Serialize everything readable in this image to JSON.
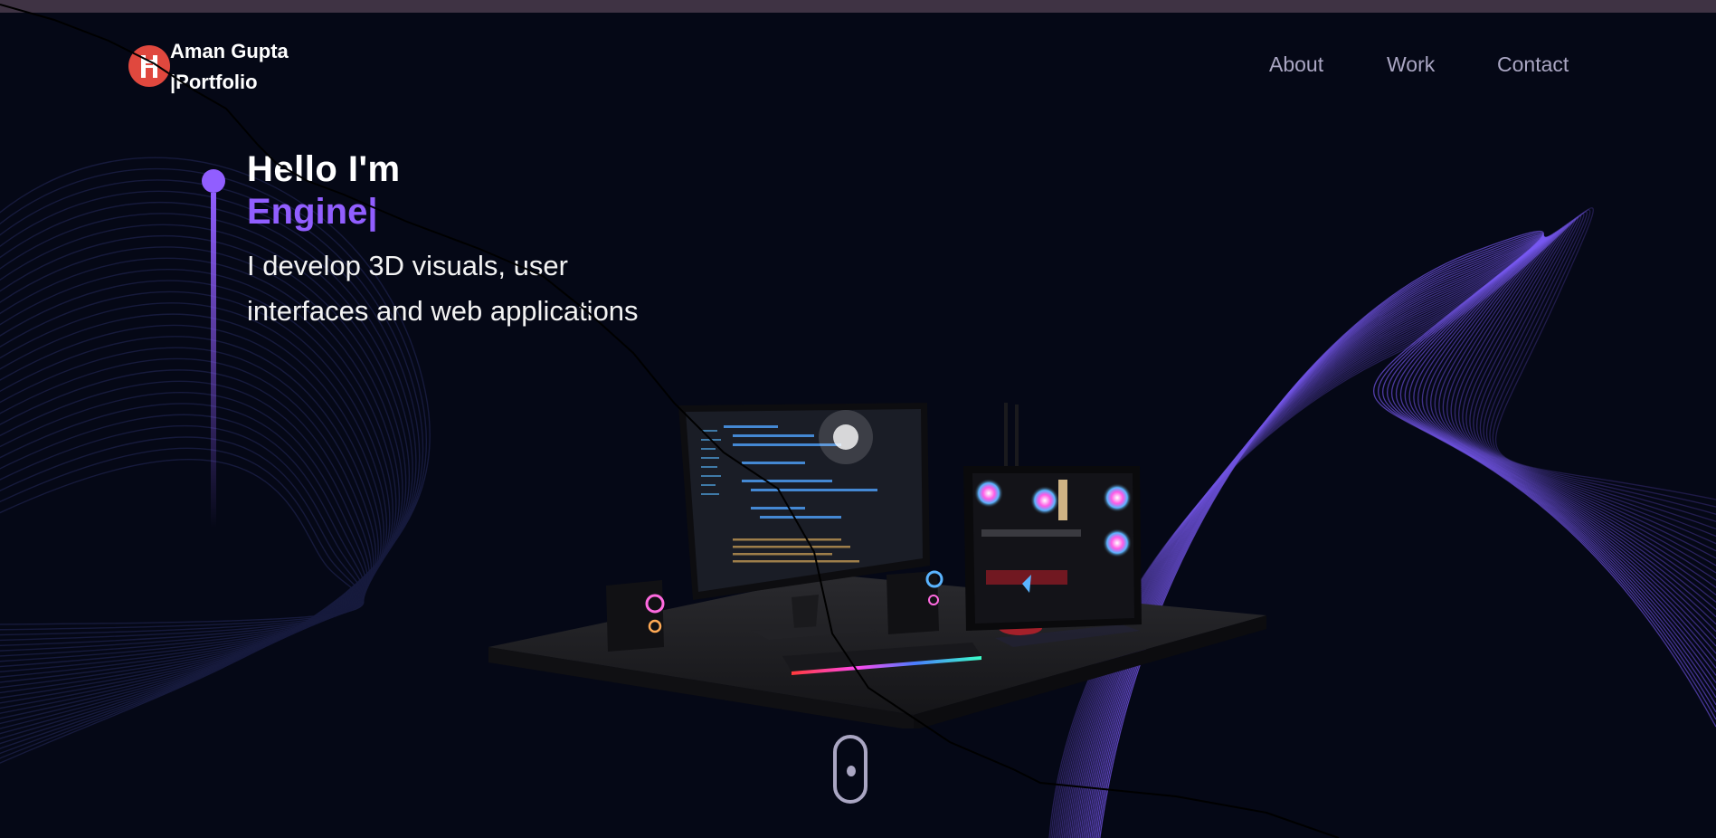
{
  "nav": {
    "brand_line1": "Aman Gupta",
    "brand_line2": "|Portfolio",
    "links": [
      {
        "label": "About"
      },
      {
        "label": "Work"
      },
      {
        "label": "Contact"
      }
    ]
  },
  "hero": {
    "greeting": "Hello I'm",
    "role": "Engine|",
    "subtitle_line1": "I develop 3D visuals, user",
    "subtitle_line2": "interfaces and web applications"
  },
  "colors": {
    "background": "#050816",
    "accent": "#915eff",
    "nav_text": "#aaa6c3",
    "logo": "#e0483e"
  },
  "icons": {
    "logo": "logo-icon",
    "scroll": "scroll-mouse-icon"
  }
}
